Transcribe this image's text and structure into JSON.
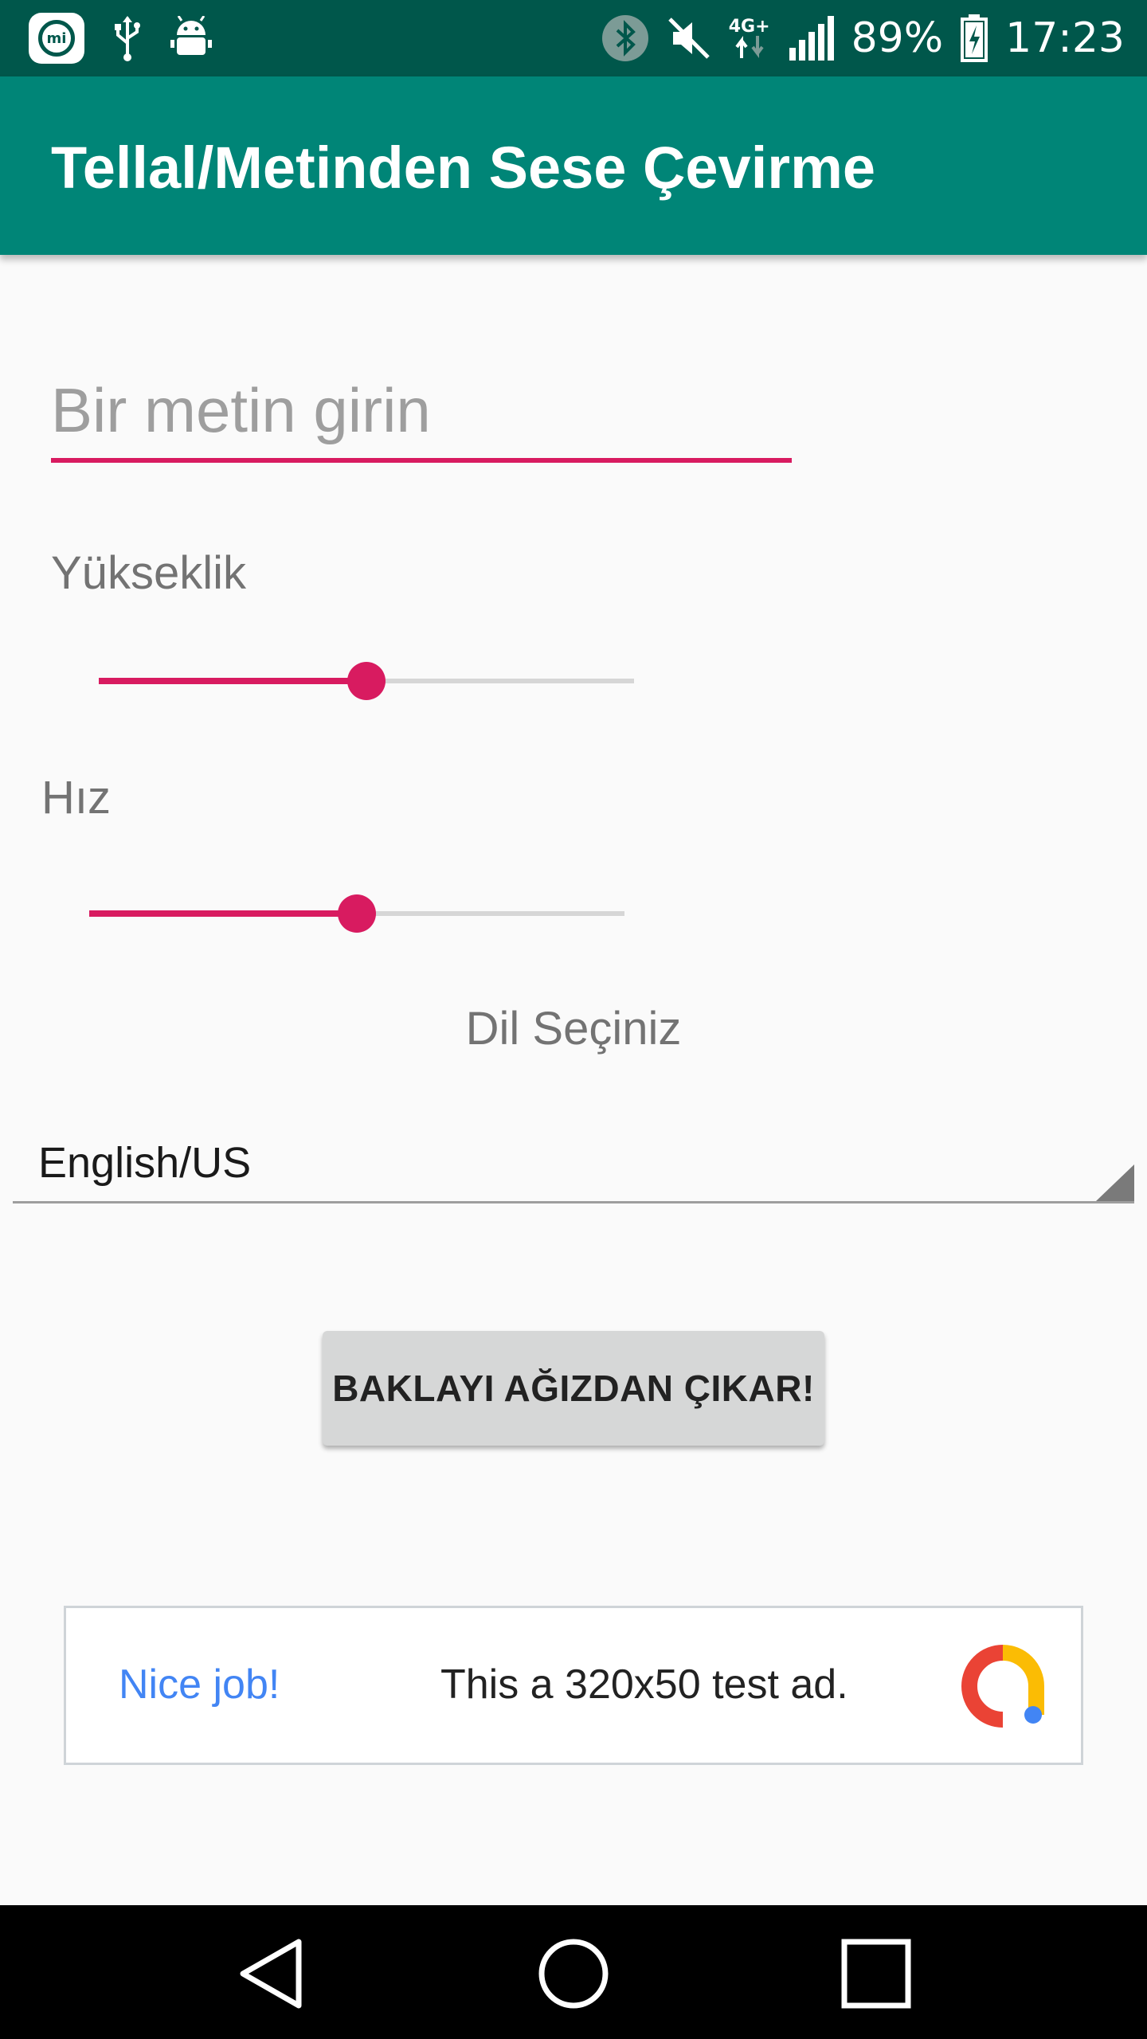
{
  "status_bar": {
    "battery_percent": "89%",
    "time": "17:23",
    "network_label": "4G+",
    "icons": [
      "mi-icon",
      "usb-icon",
      "android-debug-icon",
      "bluetooth-icon",
      "mute-icon",
      "network-icon",
      "signal-icon",
      "battery-charging-icon"
    ]
  },
  "app_bar": {
    "title": "Tellal/Metinden Sese Çevirme"
  },
  "text_input": {
    "placeholder": "Bir metin girin",
    "value": ""
  },
  "pitch": {
    "label": "Yükseklik",
    "level": 0.5
  },
  "speed": {
    "label": "Hız",
    "level": 0.5
  },
  "language": {
    "label": "Dil Seçiniz",
    "selected": "English/US"
  },
  "speak_button": {
    "label": "BAKLAYI AĞIZDAN ÇIKAR!"
  },
  "ad": {
    "nice_text": "Nice job!",
    "text": "This a 320x50 test ad."
  },
  "nav_bar": {
    "icons": [
      "back-icon",
      "home-icon",
      "recents-icon"
    ]
  },
  "colors": {
    "status_bar": "#00574b",
    "primary": "#008577",
    "accent": "#d81b60"
  }
}
